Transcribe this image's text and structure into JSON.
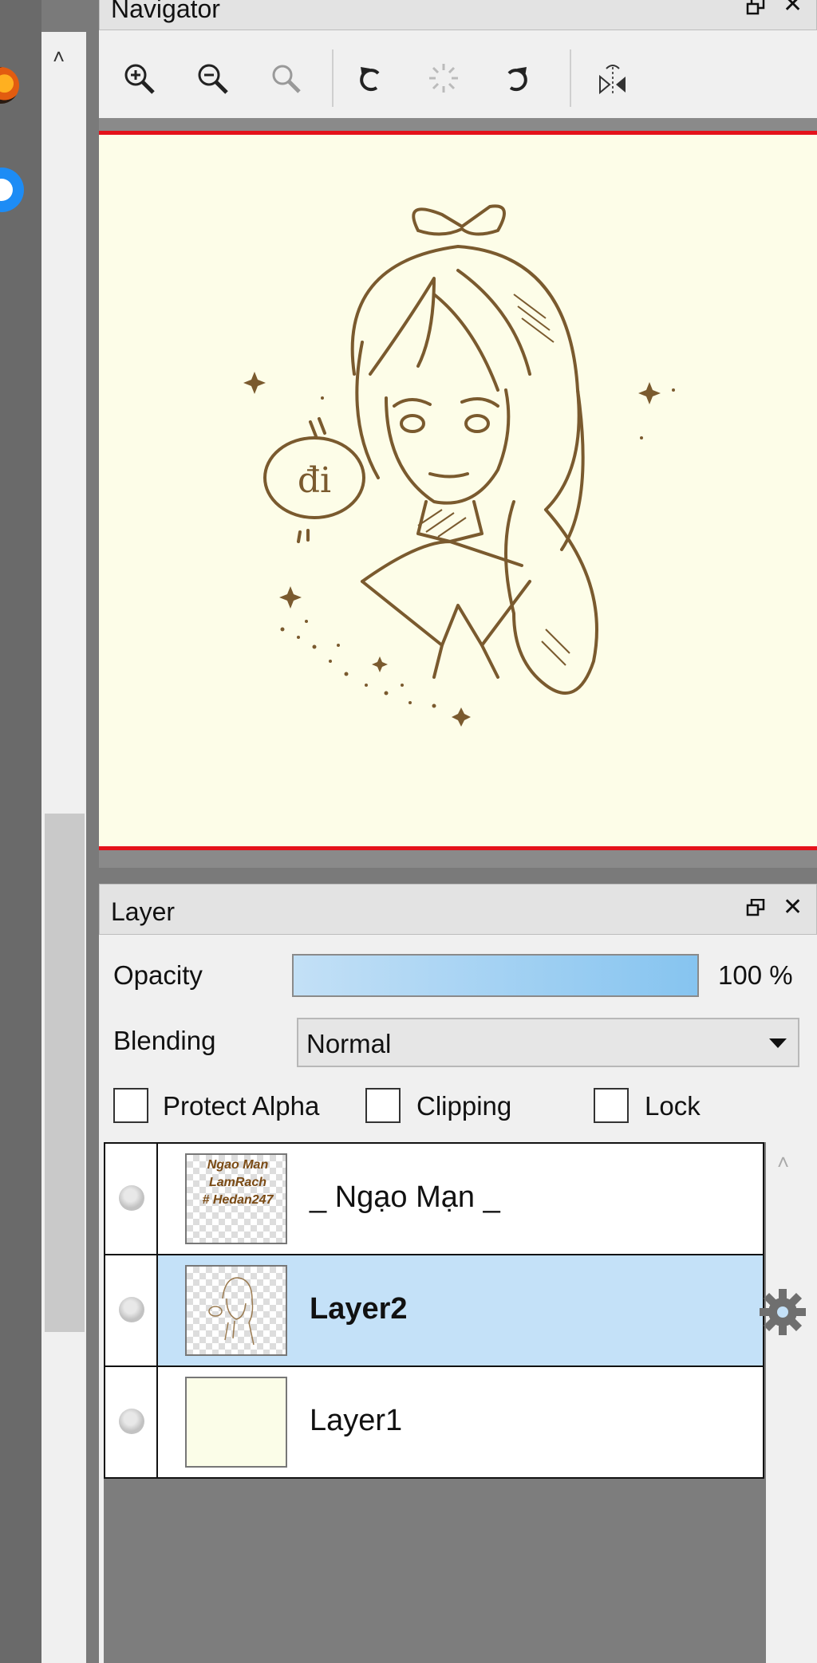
{
  "navigator": {
    "title": "Navigator",
    "tools": [
      "zoom-in",
      "zoom-out",
      "zoom-reset",
      "rotate-left",
      "rotate-reset",
      "rotate-right",
      "flip-horizontal"
    ]
  },
  "canvas": {
    "speech_bubble_text": "đi"
  },
  "layer_panel": {
    "title": "Layer",
    "opacity_label": "Opacity",
    "opacity_value": "100 %",
    "opacity_fraction": 1.0,
    "blending_label": "Blending",
    "blending_value": "Normal",
    "protect_alpha_label": "Protect Alpha",
    "clipping_label": "Clipping",
    "lock_label": "Lock",
    "layers": [
      {
        "name": "_ Ngạo Mạn _",
        "thumb_lines": [
          "Ngao Man",
          "LamRach",
          "# Hedan247"
        ],
        "selected": false
      },
      {
        "name": "Layer2",
        "selected": true
      },
      {
        "name": "Layer1",
        "selected": false
      }
    ]
  },
  "colors": {
    "accent_selection": "#c4e1f8",
    "canvas_border": "#e4121a",
    "canvas_bg": "#fdfde8",
    "line_art": "#7a5a2e"
  }
}
